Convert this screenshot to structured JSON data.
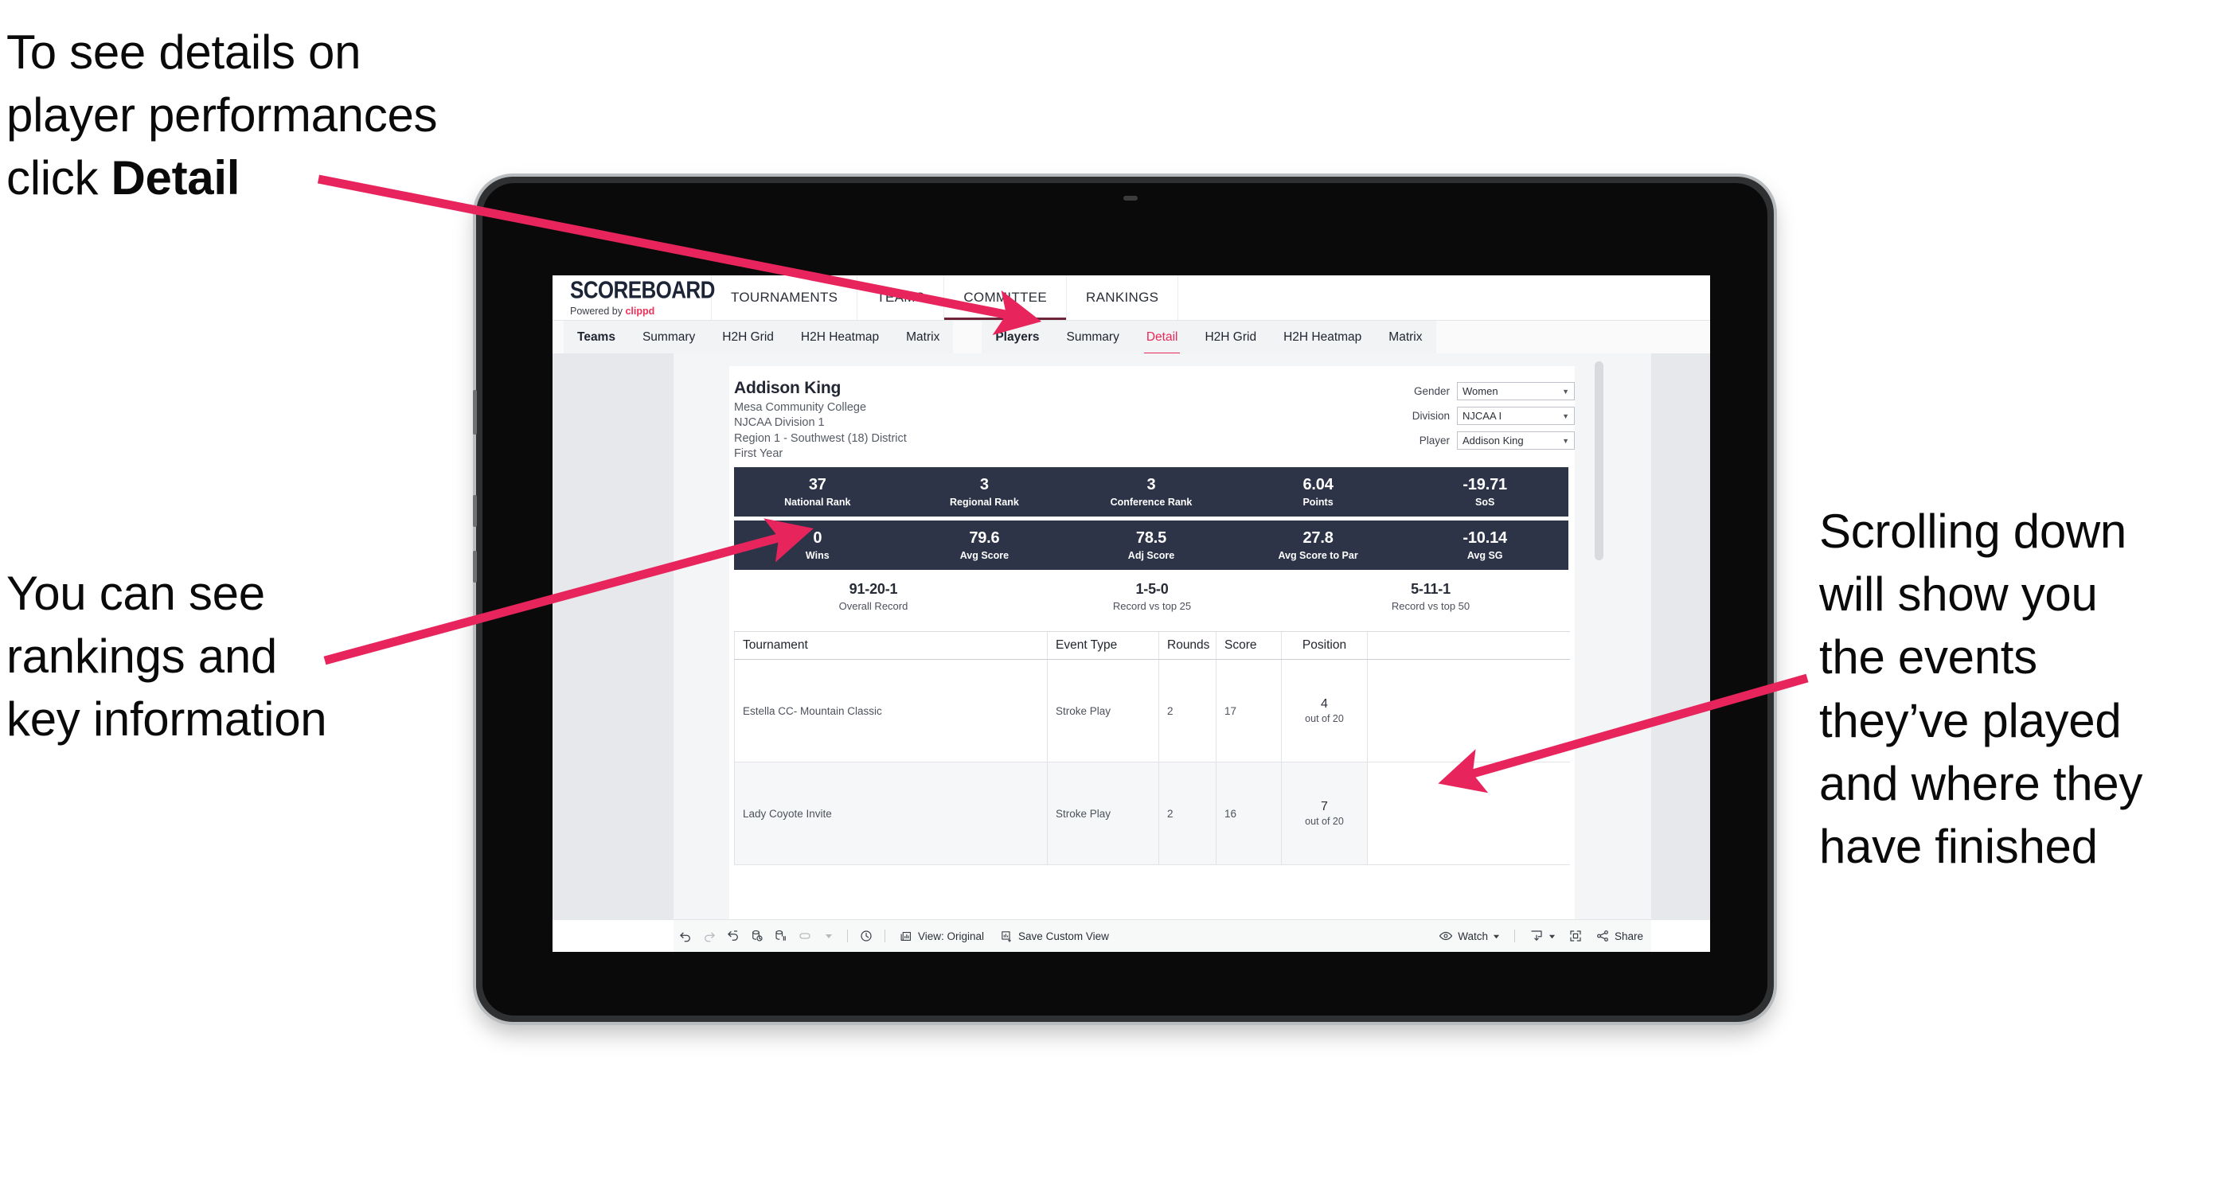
{
  "annotations": {
    "detail": {
      "line1": "To see details on",
      "line2": "player performances",
      "line3_pre": "click ",
      "line3_bold": "Detail"
    },
    "rankings": {
      "line1": "You can see",
      "line2": "rankings and",
      "line3": "key information"
    },
    "scroll": {
      "line1": "Scrolling down",
      "line2": "will show you",
      "line3": "the events",
      "line4": "they’ve played",
      "line5": "and where they",
      "line6": "have finished"
    },
    "arrow_color": "#e8245c"
  },
  "brand": {
    "title": "SCOREBOARD",
    "powered_prefix": "Powered by ",
    "powered_name": "clippd"
  },
  "topnav": {
    "items": [
      {
        "label": "TOURNAMENTS",
        "active": false
      },
      {
        "label": "TEAMS",
        "active": false
      },
      {
        "label": "COMMITTEE",
        "active": false
      },
      {
        "label": "RANKINGS",
        "active": true
      }
    ]
  },
  "subbar": {
    "group1": [
      {
        "label": "Teams",
        "strong": true,
        "active": false
      },
      {
        "label": "Summary",
        "strong": false,
        "active": false
      },
      {
        "label": "H2H Grid",
        "strong": false,
        "active": false
      },
      {
        "label": "H2H Heatmap",
        "strong": false,
        "active": false
      },
      {
        "label": "Matrix",
        "strong": false,
        "active": false
      }
    ],
    "group2": [
      {
        "label": "Players",
        "strong": true,
        "active": false
      },
      {
        "label": "Summary",
        "strong": false,
        "active": false
      },
      {
        "label": "Detail",
        "strong": false,
        "active": true
      },
      {
        "label": "H2H Grid",
        "strong": false,
        "active": false
      },
      {
        "label": "H2H Heatmap",
        "strong": false,
        "active": false
      },
      {
        "label": "Matrix",
        "strong": false,
        "active": false
      }
    ]
  },
  "player": {
    "name": "Addison King",
    "school": "Mesa Community College",
    "division": "NJCAA Division 1",
    "region": "Region 1 - Southwest (18) District",
    "year": "First Year"
  },
  "filters": [
    {
      "label": "Gender",
      "value": "Women"
    },
    {
      "label": "Division",
      "value": "NJCAA I"
    },
    {
      "label": "Player",
      "value": "Addison King"
    }
  ],
  "stats_row1": [
    {
      "value": "37",
      "label": "National Rank"
    },
    {
      "value": "3",
      "label": "Regional Rank"
    },
    {
      "value": "3",
      "label": "Conference Rank"
    },
    {
      "value": "6.04",
      "label": "Points"
    },
    {
      "value": "-19.71",
      "label": "SoS"
    }
  ],
  "stats_row2": [
    {
      "value": "0",
      "label": "Wins"
    },
    {
      "value": "79.6",
      "label": "Avg Score"
    },
    {
      "value": "78.5",
      "label": "Adj Score"
    },
    {
      "value": "27.8",
      "label": "Avg Score to Par"
    },
    {
      "value": "-10.14",
      "label": "Avg SG"
    }
  ],
  "records": [
    {
      "value": "91-20-1",
      "label": "Overall Record"
    },
    {
      "value": "1-5-0",
      "label": "Record vs top 25"
    },
    {
      "value": "5-11-1",
      "label": "Record vs top 50"
    }
  ],
  "events_table": {
    "headers": [
      "Tournament",
      "Event Type",
      "Rounds",
      "Score",
      "Position"
    ],
    "rows": [
      {
        "tournament": "Estella CC- Mountain Classic",
        "event_type": "Stroke Play",
        "rounds": "2",
        "score": "17",
        "position": "4",
        "position_sub": "out of 20"
      },
      {
        "tournament": "Lady Coyote Invite",
        "event_type": "Stroke Play",
        "rounds": "2",
        "score": "16",
        "position": "7",
        "position_sub": "out of 20"
      }
    ]
  },
  "toolbar": {
    "icons": [
      "undo-icon",
      "redo-icon",
      "revert-icon",
      "refresh-icon",
      "pause-icon",
      "highlight-icon",
      "highlight-caret-icon"
    ],
    "clock": "clock-icon",
    "view_label": "View: Original",
    "save_label": "Save Custom View",
    "watch_label": "Watch",
    "share_label": "Share"
  },
  "colors": {
    "navy": "#2d3448",
    "accent_pink": "#e8275a",
    "brand_red": "#ee3158",
    "active_underline": "#6d2438"
  }
}
